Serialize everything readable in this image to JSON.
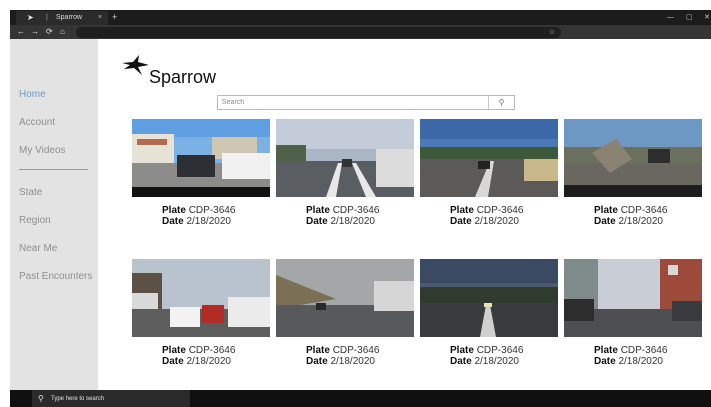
{
  "browser": {
    "tab_title": "Sparrow",
    "tab_close": "×",
    "new_tab": "+",
    "window_controls": [
      "—",
      "▢",
      "✕"
    ],
    "nav_buttons": [
      "←",
      "→",
      "⟳",
      "⌂"
    ],
    "bookmark_icon": "star-icon",
    "bookmark_glyph": "☆"
  },
  "sidebar": {
    "items": [
      {
        "label": "Home",
        "active": true
      },
      {
        "label": "Account"
      },
      {
        "label": "My Videos"
      },
      {
        "label": "State"
      },
      {
        "label": "Region"
      },
      {
        "label": "Near Me"
      },
      {
        "label": "Past Encounters"
      }
    ]
  },
  "header": {
    "logo_text": "Sparrow"
  },
  "search": {
    "placeholder": "Search",
    "button_glyph": "⚲"
  },
  "videos": [
    {
      "plate_label": "Plate",
      "plate": "CDP-3646",
      "date_label": "Date",
      "date": "2/18/2020"
    },
    {
      "plate_label": "Plate",
      "plate": "CDP-3646",
      "date_label": "Date",
      "date": "2/18/2020"
    },
    {
      "plate_label": "Plate",
      "plate": "CDP-3646",
      "date_label": "Date",
      "date": "2/18/2020"
    },
    {
      "plate_label": "Plate",
      "plate": "CDP-3646",
      "date_label": "Date",
      "date": "2/18/2020"
    },
    {
      "plate_label": "Plate",
      "plate": "CDP-3646",
      "date_label": "Date",
      "date": "2/18/2020"
    },
    {
      "plate_label": "Plate",
      "plate": "CDP-3646",
      "date_label": "Date",
      "date": "2/18/2020"
    },
    {
      "plate_label": "Plate",
      "plate": "CDP-3646",
      "date_label": "Date",
      "date": "2/18/2020"
    },
    {
      "plate_label": "Plate",
      "plate": "CDP-3646",
      "date_label": "Date",
      "date": "2/18/2020"
    }
  ],
  "taskbar": {
    "search_text": "Type here to search"
  },
  "colors": {
    "sidebar_bg": "#e3e3e3",
    "active_link": "#6d9cc4",
    "inactive_link": "#8f8f8f",
    "chrome_dark": "#1c1c1c"
  }
}
